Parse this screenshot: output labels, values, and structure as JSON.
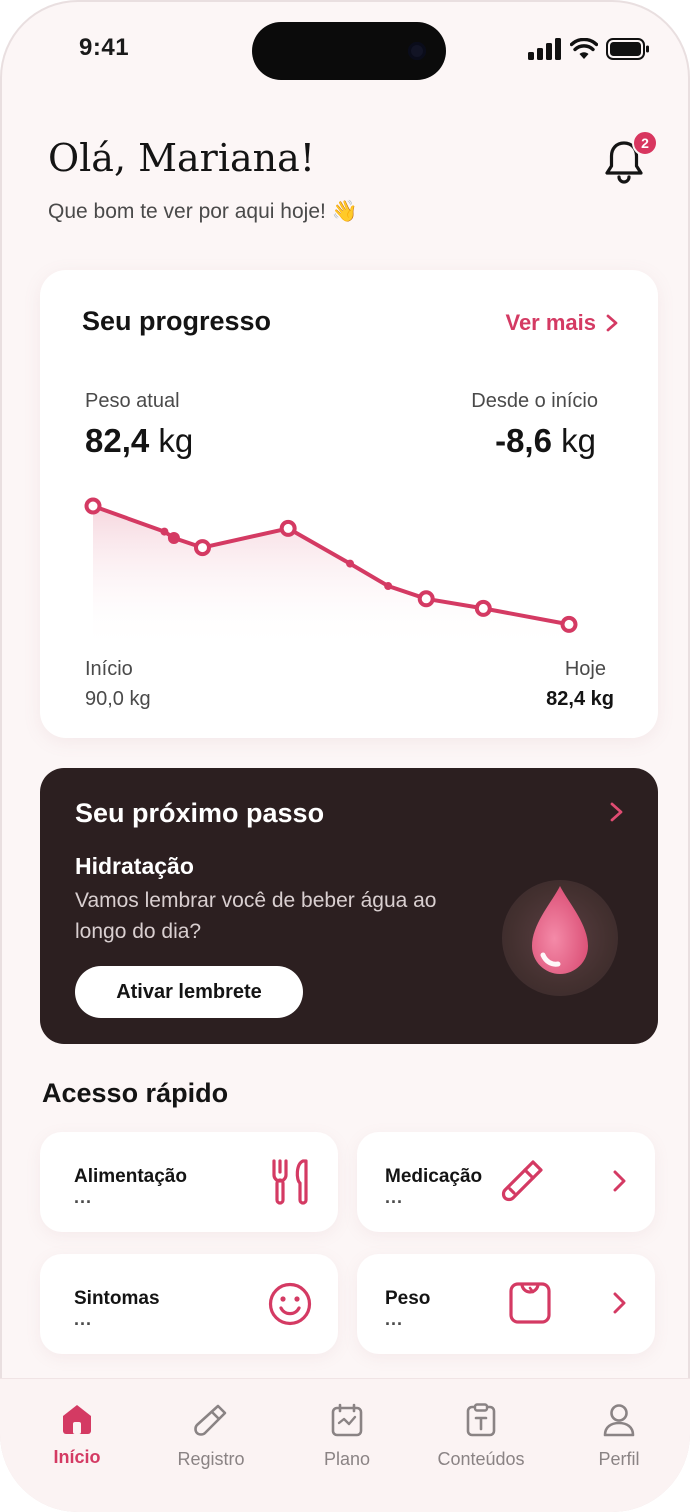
{
  "status": {
    "time": "9:41"
  },
  "header": {
    "greeting": "Olá, Mariana!",
    "subtitle": "Que bom te ver por aqui hoje! 👋",
    "notification_count": "2"
  },
  "progress": {
    "title": "Seu progresso",
    "see_more": "Ver mais",
    "current_label": "Peso atual",
    "current_value": "82,4",
    "current_unit": "kg",
    "change_label": "Desde o início",
    "change_value": "-8,6",
    "change_unit": "kg",
    "start_label": "Início",
    "start_value": "90,0 kg",
    "today_label": "Hoje",
    "today_value": "82,4 kg"
  },
  "chart_data": {
    "type": "line",
    "series": [
      {
        "values": [
          90.0,
          89.2,
          89.0,
          88.7,
          89.3,
          88.2,
          87.5,
          87.1,
          86.8,
          86.3
        ]
      }
    ],
    "x": [
      0,
      0.15,
      0.17,
      0.23,
      0.41,
      0.54,
      0.62,
      0.7,
      0.82,
      1.0
    ],
    "marker_points": [
      0,
      3,
      4,
      7,
      8,
      9
    ],
    "ylim": [
      85.5,
      90.5
    ],
    "area_fill": true,
    "grid": false,
    "colors": {
      "line": "#d43a63",
      "fill": "#f3c9d3"
    }
  },
  "next_step": {
    "title": "Seu próximo passo",
    "subtitle": "Hidratação",
    "description": "Vamos lembrar você de beber água ao longo do dia?",
    "button": "Ativar lembrete",
    "icon": "water-drop-icon"
  },
  "quick_access": {
    "title": "Acesso rápido",
    "items": [
      {
        "label": "Alimentação",
        "dots": "...",
        "icon": "fork-knife-icon"
      },
      {
        "label": "Medicação",
        "dots": "...",
        "icon": "syringe-pen-icon"
      },
      {
        "label": "Sintomas",
        "dots": "...",
        "icon": "smile-icon"
      },
      {
        "label": "Peso",
        "dots": "...",
        "icon": "scale-icon"
      }
    ]
  },
  "tabs": [
    {
      "label": "Início",
      "icon": "home-icon",
      "active": true
    },
    {
      "label": "Registro",
      "icon": "pen-icon",
      "active": false
    },
    {
      "label": "Plano",
      "icon": "plan-icon",
      "active": false
    },
    {
      "label": "Conteúdos",
      "icon": "content-icon",
      "active": false
    },
    {
      "label": "Perfil",
      "icon": "profile-icon",
      "active": false
    }
  ],
  "colors": {
    "accent": "#d43a63",
    "background": "#fcf6f6",
    "dark_card": "#2c1f20"
  }
}
